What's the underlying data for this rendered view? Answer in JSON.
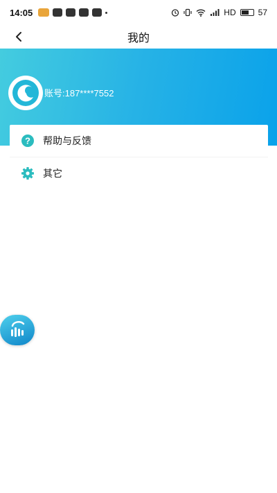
{
  "status_bar": {
    "time": "14:05",
    "network": "HD",
    "battery": "57",
    "battery_level": 0.57
  },
  "header": {
    "title": "我的",
    "back_icon": "chevron-left-icon"
  },
  "profile": {
    "avatar_icon": "app-logo-icon",
    "account": "账号:187****7552"
  },
  "menu": {
    "items": [
      {
        "label": "帮助与反馈",
        "icon": "help-circle-icon"
      },
      {
        "label": "其它",
        "icon": "gear-icon"
      }
    ]
  },
  "float_button": {
    "icon": "voice-wave-icon"
  },
  "colors": {
    "accent": "#1fb0e6",
    "icon_teal": "#2bbcbf"
  }
}
